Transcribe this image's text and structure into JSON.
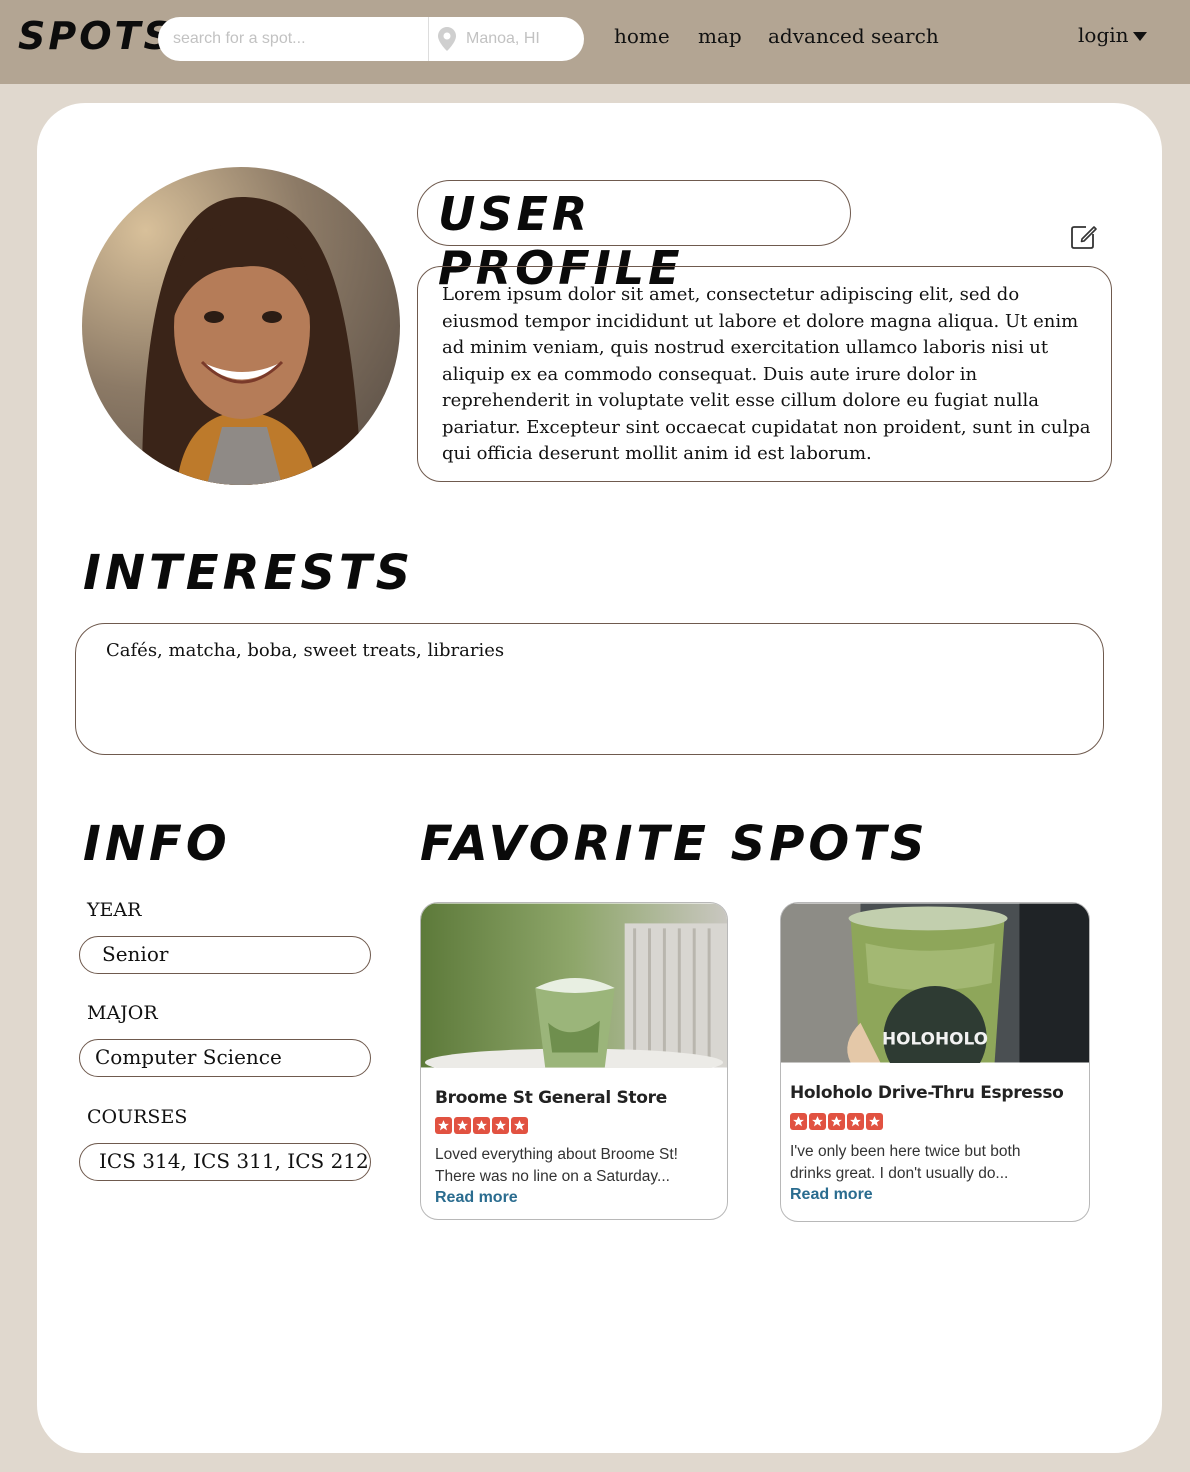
{
  "header": {
    "logo": "SPOTS",
    "search_placeholder": "search for a spot...",
    "location_placeholder": "Manoa, HI",
    "nav": [
      "home",
      "map",
      "advanced search"
    ],
    "login": "login"
  },
  "profile": {
    "title": "USER PROFILE",
    "bio": "Lorem ipsum dolor sit amet, consectetur adipiscing elit, sed do eiusmod tempor incididunt ut labore et dolore magna aliqua. Ut enim ad minim veniam, quis nostrud exercitation ullamco laboris nisi ut aliquip ex ea commodo consequat. Duis aute irure dolor in reprehenderit in voluptate velit esse cillum dolore eu fugiat nulla pariatur. Excepteur sint occaecat cupidatat non proident, sunt in culpa qui officia deserunt mollit anim id est laborum."
  },
  "interests": {
    "title": "INTERESTS",
    "text": "Cafés, matcha, boba, sweet treats, libraries"
  },
  "info": {
    "title": "INFO",
    "year_label": "YEAR",
    "year": "Senior",
    "major_label": "MAJOR",
    "major": "Computer Science",
    "courses_label": "COURSES",
    "courses": "ICS 314, ICS 311, ICS 212"
  },
  "favorites": {
    "title": "FAVORITE SPOTS",
    "spots": [
      {
        "name": "Broome St General Store",
        "rating": 5,
        "review_line1": "Loved everything about Broome St!",
        "review_line2": "There was no line on a Saturday...",
        "read_more": "Read more",
        "photo_badge": ""
      },
      {
        "name": "Holoholo Drive-Thru Espresso",
        "rating": 5,
        "review_line1": "I've only been here twice but both",
        "review_line2": "drinks great. I don't usually do...",
        "read_more": "Read more",
        "photo_badge": "HOLOHOLO"
      }
    ]
  },
  "colors": {
    "header_bg": "#b3a593",
    "page_bg": "#e0d8ce",
    "outline": "#6f5a4e",
    "star_red": "#e15241",
    "link_blue": "#2a6c8f"
  }
}
